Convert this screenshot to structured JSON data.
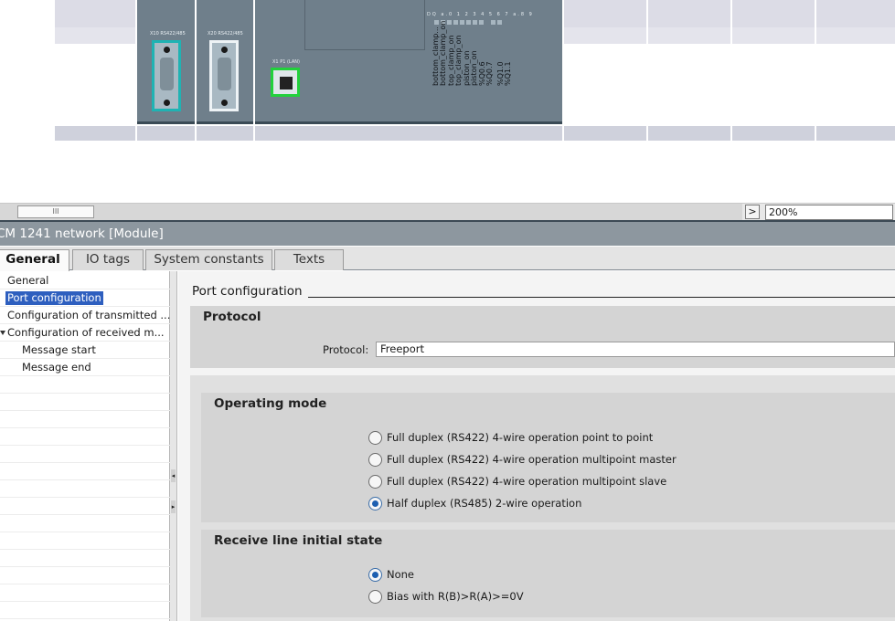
{
  "device_view": {
    "port_labels": [
      "X10 RS422/485",
      "X20 RS422/485",
      "X1 P1 (LAN)"
    ],
    "io_header": "DQ a.0  1  2  3  4  5  6  7   a.8  9",
    "tags": [
      "bottom_clamp...",
      "bottom_clamp_on",
      "top_clamp_on",
      "top_clamp_on",
      "piston_on",
      "piston_on",
      "%Q0.6",
      "%Q0.7",
      "%Q1.0",
      "%Q1.1"
    ]
  },
  "toolbar": {
    "scroll_thumb_label": "III",
    "scroll_right_label": ">",
    "zoom_value": "200%"
  },
  "inspector": {
    "title": "CM 1241 network [Module]",
    "tabs": [
      {
        "label": "General"
      },
      {
        "label": "IO tags"
      },
      {
        "label": "System constants"
      },
      {
        "label": "Texts"
      }
    ]
  },
  "nav": {
    "items": [
      {
        "label": "General"
      },
      {
        "label": "Port configuration"
      },
      {
        "label": "Configuration of transmitted ..."
      },
      {
        "label": "Configuration of received m..."
      },
      {
        "label": "Message start"
      },
      {
        "label": "Message end"
      }
    ]
  },
  "content": {
    "section_title": "Port configuration",
    "protocol": {
      "panel_title": "Protocol",
      "field_label": "Protocol:",
      "field_value": "Freeport"
    },
    "operating_mode": {
      "panel_title": "Operating mode",
      "options": [
        {
          "label": "Full duplex (RS422) 4-wire operation point to point",
          "selected": false
        },
        {
          "label": "Full duplex (RS422) 4-wire operation multipoint master",
          "selected": false
        },
        {
          "label": "Full duplex (RS422) 4-wire operation multipoint slave",
          "selected": false
        },
        {
          "label": "Half duplex (RS485) 2-wire operation",
          "selected": true
        }
      ]
    },
    "receive_line": {
      "panel_title": "Receive line initial state",
      "options": [
        {
          "label": "None",
          "selected": true
        },
        {
          "label": "Bias with R(B)>R(A)>=0V",
          "selected": false
        }
      ]
    }
  },
  "colors": {
    "selection": "#2e5fbf",
    "module_body": "#6f7f8b",
    "port_highlight": "#1fb3b3",
    "lan_highlight": "#22d13c",
    "panel_bg": "#d4d4d4"
  }
}
